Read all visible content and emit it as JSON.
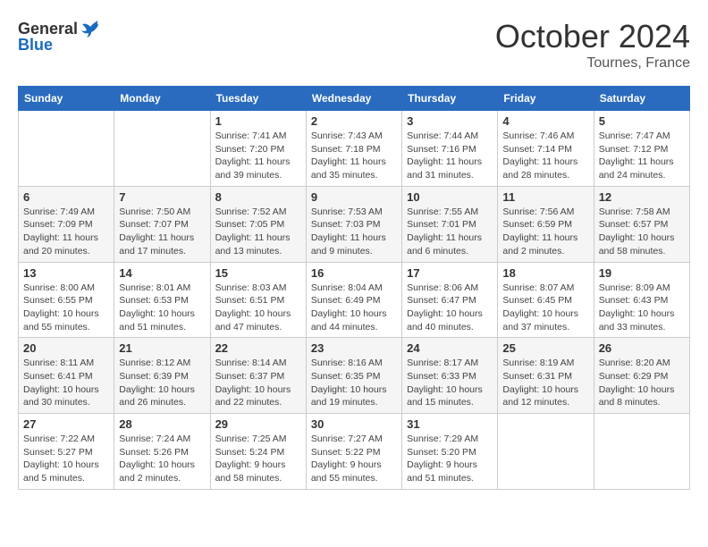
{
  "header": {
    "logo": {
      "general": "General",
      "blue": "Blue"
    },
    "title": "October 2024",
    "location": "Tournes, France"
  },
  "days_of_week": [
    "Sunday",
    "Monday",
    "Tuesday",
    "Wednesday",
    "Thursday",
    "Friday",
    "Saturday"
  ],
  "weeks": [
    [
      {
        "day": null
      },
      {
        "day": null
      },
      {
        "day": "1",
        "sunrise": "Sunrise: 7:41 AM",
        "sunset": "Sunset: 7:20 PM",
        "daylight": "Daylight: 11 hours and 39 minutes."
      },
      {
        "day": "2",
        "sunrise": "Sunrise: 7:43 AM",
        "sunset": "Sunset: 7:18 PM",
        "daylight": "Daylight: 11 hours and 35 minutes."
      },
      {
        "day": "3",
        "sunrise": "Sunrise: 7:44 AM",
        "sunset": "Sunset: 7:16 PM",
        "daylight": "Daylight: 11 hours and 31 minutes."
      },
      {
        "day": "4",
        "sunrise": "Sunrise: 7:46 AM",
        "sunset": "Sunset: 7:14 PM",
        "daylight": "Daylight: 11 hours and 28 minutes."
      },
      {
        "day": "5",
        "sunrise": "Sunrise: 7:47 AM",
        "sunset": "Sunset: 7:12 PM",
        "daylight": "Daylight: 11 hours and 24 minutes."
      }
    ],
    [
      {
        "day": "6",
        "sunrise": "Sunrise: 7:49 AM",
        "sunset": "Sunset: 7:09 PM",
        "daylight": "Daylight: 11 hours and 20 minutes."
      },
      {
        "day": "7",
        "sunrise": "Sunrise: 7:50 AM",
        "sunset": "Sunset: 7:07 PM",
        "daylight": "Daylight: 11 hours and 17 minutes."
      },
      {
        "day": "8",
        "sunrise": "Sunrise: 7:52 AM",
        "sunset": "Sunset: 7:05 PM",
        "daylight": "Daylight: 11 hours and 13 minutes."
      },
      {
        "day": "9",
        "sunrise": "Sunrise: 7:53 AM",
        "sunset": "Sunset: 7:03 PM",
        "daylight": "Daylight: 11 hours and 9 minutes."
      },
      {
        "day": "10",
        "sunrise": "Sunrise: 7:55 AM",
        "sunset": "Sunset: 7:01 PM",
        "daylight": "Daylight: 11 hours and 6 minutes."
      },
      {
        "day": "11",
        "sunrise": "Sunrise: 7:56 AM",
        "sunset": "Sunset: 6:59 PM",
        "daylight": "Daylight: 11 hours and 2 minutes."
      },
      {
        "day": "12",
        "sunrise": "Sunrise: 7:58 AM",
        "sunset": "Sunset: 6:57 PM",
        "daylight": "Daylight: 10 hours and 58 minutes."
      }
    ],
    [
      {
        "day": "13",
        "sunrise": "Sunrise: 8:00 AM",
        "sunset": "Sunset: 6:55 PM",
        "daylight": "Daylight: 10 hours and 55 minutes."
      },
      {
        "day": "14",
        "sunrise": "Sunrise: 8:01 AM",
        "sunset": "Sunset: 6:53 PM",
        "daylight": "Daylight: 10 hours and 51 minutes."
      },
      {
        "day": "15",
        "sunrise": "Sunrise: 8:03 AM",
        "sunset": "Sunset: 6:51 PM",
        "daylight": "Daylight: 10 hours and 47 minutes."
      },
      {
        "day": "16",
        "sunrise": "Sunrise: 8:04 AM",
        "sunset": "Sunset: 6:49 PM",
        "daylight": "Daylight: 10 hours and 44 minutes."
      },
      {
        "day": "17",
        "sunrise": "Sunrise: 8:06 AM",
        "sunset": "Sunset: 6:47 PM",
        "daylight": "Daylight: 10 hours and 40 minutes."
      },
      {
        "day": "18",
        "sunrise": "Sunrise: 8:07 AM",
        "sunset": "Sunset: 6:45 PM",
        "daylight": "Daylight: 10 hours and 37 minutes."
      },
      {
        "day": "19",
        "sunrise": "Sunrise: 8:09 AM",
        "sunset": "Sunset: 6:43 PM",
        "daylight": "Daylight: 10 hours and 33 minutes."
      }
    ],
    [
      {
        "day": "20",
        "sunrise": "Sunrise: 8:11 AM",
        "sunset": "Sunset: 6:41 PM",
        "daylight": "Daylight: 10 hours and 30 minutes."
      },
      {
        "day": "21",
        "sunrise": "Sunrise: 8:12 AM",
        "sunset": "Sunset: 6:39 PM",
        "daylight": "Daylight: 10 hours and 26 minutes."
      },
      {
        "day": "22",
        "sunrise": "Sunrise: 8:14 AM",
        "sunset": "Sunset: 6:37 PM",
        "daylight": "Daylight: 10 hours and 22 minutes."
      },
      {
        "day": "23",
        "sunrise": "Sunrise: 8:16 AM",
        "sunset": "Sunset: 6:35 PM",
        "daylight": "Daylight: 10 hours and 19 minutes."
      },
      {
        "day": "24",
        "sunrise": "Sunrise: 8:17 AM",
        "sunset": "Sunset: 6:33 PM",
        "daylight": "Daylight: 10 hours and 15 minutes."
      },
      {
        "day": "25",
        "sunrise": "Sunrise: 8:19 AM",
        "sunset": "Sunset: 6:31 PM",
        "daylight": "Daylight: 10 hours and 12 minutes."
      },
      {
        "day": "26",
        "sunrise": "Sunrise: 8:20 AM",
        "sunset": "Sunset: 6:29 PM",
        "daylight": "Daylight: 10 hours and 8 minutes."
      }
    ],
    [
      {
        "day": "27",
        "sunrise": "Sunrise: 7:22 AM",
        "sunset": "Sunset: 5:27 PM",
        "daylight": "Daylight: 10 hours and 5 minutes."
      },
      {
        "day": "28",
        "sunrise": "Sunrise: 7:24 AM",
        "sunset": "Sunset: 5:26 PM",
        "daylight": "Daylight: 10 hours and 2 minutes."
      },
      {
        "day": "29",
        "sunrise": "Sunrise: 7:25 AM",
        "sunset": "Sunset: 5:24 PM",
        "daylight": "Daylight: 9 hours and 58 minutes."
      },
      {
        "day": "30",
        "sunrise": "Sunrise: 7:27 AM",
        "sunset": "Sunset: 5:22 PM",
        "daylight": "Daylight: 9 hours and 55 minutes."
      },
      {
        "day": "31",
        "sunrise": "Sunrise: 7:29 AM",
        "sunset": "Sunset: 5:20 PM",
        "daylight": "Daylight: 9 hours and 51 minutes."
      },
      {
        "day": null
      },
      {
        "day": null
      }
    ]
  ]
}
